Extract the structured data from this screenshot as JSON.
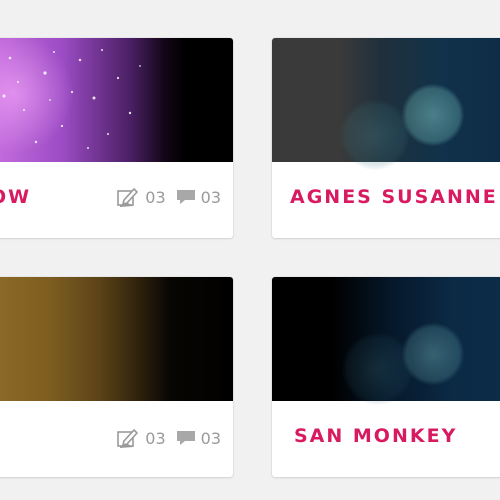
{
  "cards": [
    {
      "title": "OW",
      "stats": {
        "edits": "03",
        "comments": "03"
      }
    },
    {
      "title": "AGNES SUSANNE H"
    },
    {
      "title": "",
      "stats": {
        "edits": "03",
        "comments": "03"
      }
    },
    {
      "title": "SAN MONKEY"
    }
  ],
  "colors": {
    "title": "#d81b60",
    "stat_text": "#9a9a9a",
    "page_bg": "#f1f1f1"
  },
  "icons": {
    "edit": "edit-icon",
    "comment": "comment-icon"
  }
}
